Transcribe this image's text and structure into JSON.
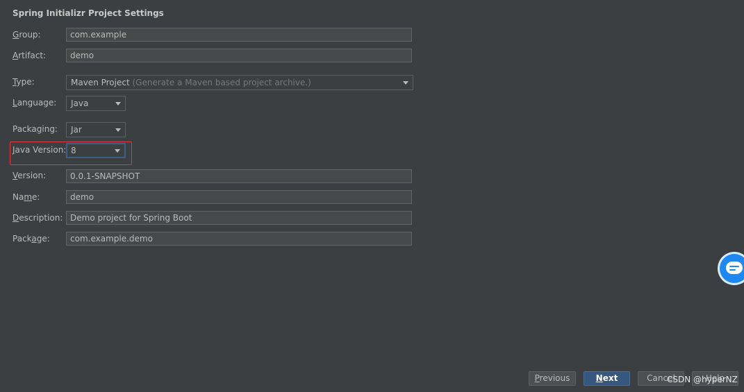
{
  "title": "Spring Initializr Project Settings",
  "fields": {
    "group": {
      "label_key": "G",
      "label_rest": "roup:",
      "value": "com.example"
    },
    "artifact": {
      "label_key": "A",
      "label_rest": "rtifact:",
      "value": "demo"
    },
    "type": {
      "label_key": "T",
      "label_rest": "ype:",
      "value": "Maven Project",
      "hint": "(Generate a Maven based project archive.)"
    },
    "language": {
      "label_key": "L",
      "label_rest": "anguage:",
      "value": "Java"
    },
    "packaging": {
      "label_pre": "Packa",
      "label_key": "g",
      "label_rest": "ing:",
      "value": "Jar"
    },
    "java_version": {
      "label_key": "J",
      "label_rest": "ava Version:",
      "value": "8"
    },
    "version": {
      "label_key": "V",
      "label_rest": "ersion:",
      "value": "0.0.1-SNAPSHOT"
    },
    "name": {
      "label_pre": "Na",
      "label_key": "m",
      "label_rest": "e:",
      "value": "demo"
    },
    "description": {
      "label_key": "D",
      "label_rest": "escription:",
      "value": "Demo project for Spring Boot"
    },
    "package": {
      "label_pre": "Pack",
      "label_key": "a",
      "label_rest": "ge:",
      "value": "com.example.demo"
    }
  },
  "buttons": {
    "previous": {
      "key": "P",
      "rest": "revious"
    },
    "next": {
      "key": "N",
      "rest": "ext"
    },
    "cancel": "Cancel",
    "help": "Help"
  },
  "watermark": "CSDN @hyperNZ",
  "colors": {
    "background": "#3c3f41",
    "highlight_box": "#e2383f",
    "primary_button": "#365880",
    "focus_border": "#3d6185"
  }
}
